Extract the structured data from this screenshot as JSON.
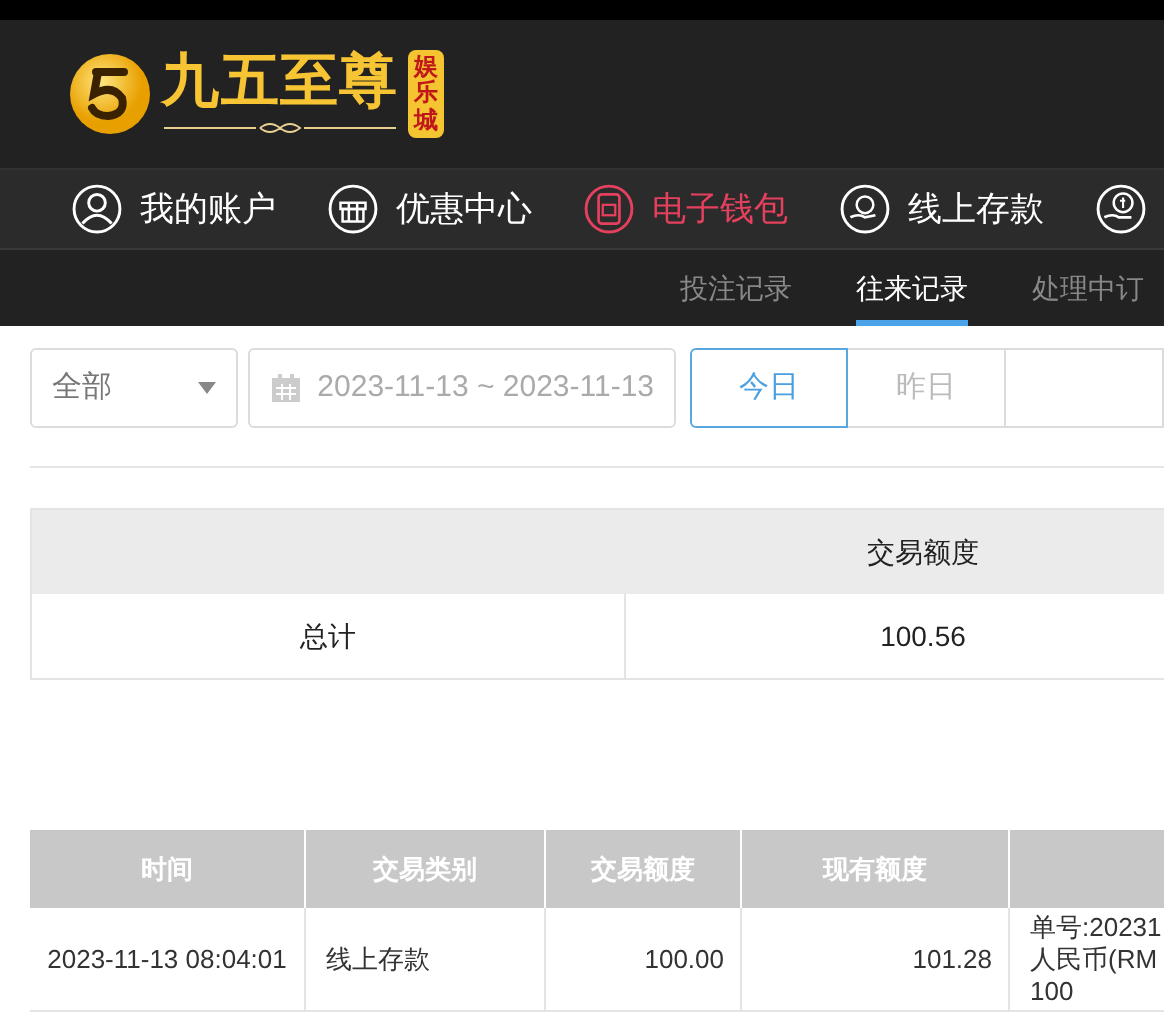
{
  "logo": {
    "name": "九五至尊",
    "badge": "娱乐城"
  },
  "nav": [
    {
      "label": "我的账户",
      "kind": "user",
      "selected": false
    },
    {
      "label": "优惠中心",
      "kind": "gift",
      "selected": false
    },
    {
      "label": "电子钱包",
      "kind": "wallet",
      "selected": true
    },
    {
      "label": "线上存款",
      "kind": "hand",
      "selected": false
    },
    {
      "kind": "coin",
      "selected": false
    }
  ],
  "subnav": [
    {
      "label": "投注记录",
      "selected": false
    },
    {
      "label": "往来记录",
      "selected": true
    },
    {
      "label": "处理中订",
      "selected": false
    }
  ],
  "filters": {
    "type_select": "全部",
    "date_range": "2023-11-13 ~ 2023-11-13",
    "quick_buttons": [
      {
        "label": "今日",
        "selected": true
      },
      {
        "label": "昨日",
        "selected": false
      },
      {
        "selected": false
      }
    ]
  },
  "summary": {
    "header": "交易额度",
    "label": "总计",
    "value": "100.56"
  },
  "records": {
    "columns": [
      "时间",
      "交易类别",
      "交易额度",
      "现有额度"
    ],
    "rows": [
      {
        "time": "2023-11-13 08:04:01",
        "type": "线上存款",
        "amount": "100.00",
        "balance": "101.28",
        "details": [
          "单号:20231",
          "人民币(RM",
          "100"
        ]
      }
    ]
  }
}
